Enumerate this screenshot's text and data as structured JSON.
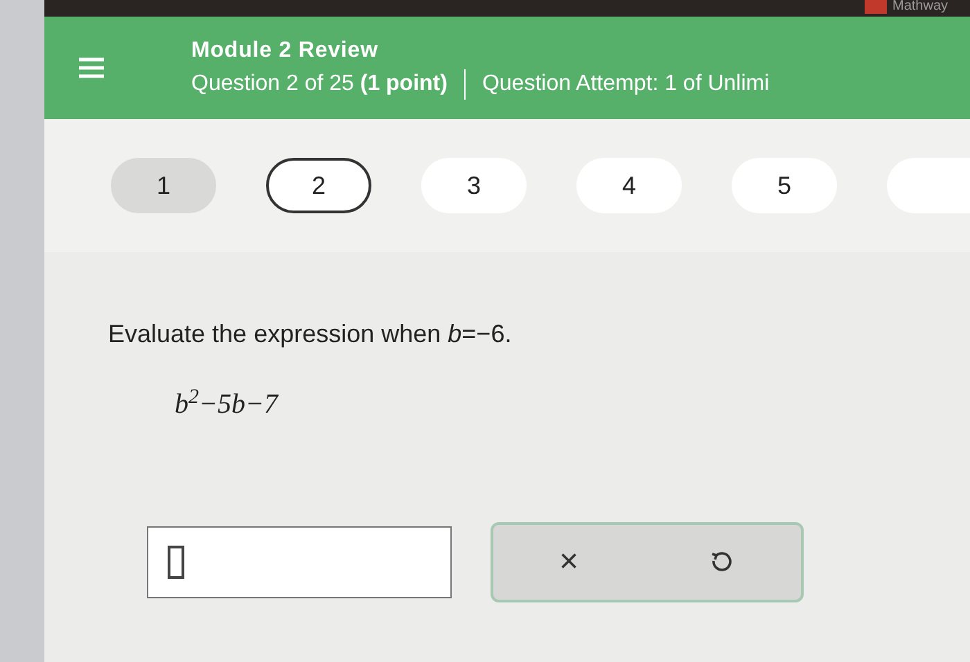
{
  "top_bar": {
    "tab_label": "Mathway"
  },
  "header": {
    "title": "Module 2 Review",
    "subtitle": "Question 2 of 25 **(1 point)**",
    "attempt": "Question Attempt: 1 of Unlimi"
  },
  "question_nav": [
    {
      "label": "1",
      "answered": true,
      "selected": false
    },
    {
      "label": "2",
      "answered": false,
      "selected": true
    },
    {
      "label": "3",
      "answered": false,
      "selected": false
    },
    {
      "label": "4",
      "answered": false,
      "selected": false
    },
    {
      "label": "5",
      "answered": false,
      "selected": false
    }
  ],
  "question": {
    "prompt": "Evaluate the expression when *b*=−6.",
    "expression": "b$^{2}$−5b−7"
  },
  "answer": {
    "clear_symbol": "×"
  }
}
